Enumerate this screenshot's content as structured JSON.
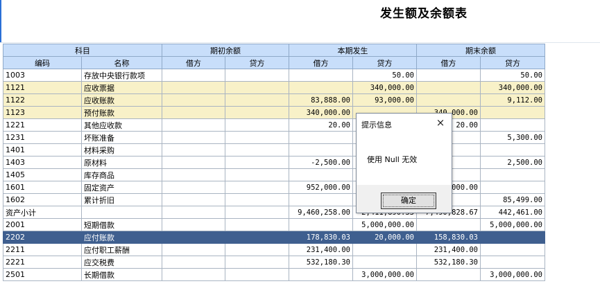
{
  "title": "发生额及余额表",
  "headers": {
    "group": [
      "科目",
      "期初余额",
      "本期发生",
      "期末余额"
    ],
    "sub": [
      "编码",
      "名称",
      "借方",
      "贷方",
      "借方",
      "贷方",
      "借方",
      "贷方"
    ]
  },
  "rows": [
    {
      "code": "1003",
      "name": "存放中央银行款项",
      "ob_debit": "",
      "ob_credit": "",
      "p_debit": "",
      "p_credit": "50.00",
      "cb_debit": "",
      "cb_credit": "50.00",
      "style": ""
    },
    {
      "code": "1121",
      "name": "应收票据",
      "ob_debit": "",
      "ob_credit": "",
      "p_debit": "",
      "p_credit": "340,000.00",
      "cb_debit": "",
      "cb_credit": "340,000.00",
      "style": "hl"
    },
    {
      "code": "1122",
      "name": "应收账款",
      "ob_debit": "",
      "ob_credit": "",
      "p_debit": "83,888.00",
      "p_credit": "93,000.00",
      "cb_debit": "",
      "cb_credit": "9,112.00",
      "style": "hl"
    },
    {
      "code": "1123",
      "name": "预付账款",
      "ob_debit": "",
      "ob_credit": "",
      "p_debit": "340,000.00",
      "p_credit": "",
      "cb_debit": "340,000.00",
      "cb_credit": "",
      "style": "hl"
    },
    {
      "code": "1221",
      "name": "其他应收款",
      "ob_debit": "",
      "ob_credit": "",
      "p_debit": "20.00",
      "p_credit": "",
      "cb_debit": "20.00",
      "cb_credit": "",
      "style": ""
    },
    {
      "code": "1231",
      "name": "坏账准备",
      "ob_debit": "",
      "ob_credit": "",
      "p_debit": "",
      "p_credit": "",
      "cb_debit": "",
      "cb_credit": "5,300.00",
      "style": ""
    },
    {
      "code": "1401",
      "name": "材料采购",
      "ob_debit": "",
      "ob_credit": "",
      "p_debit": "",
      "p_credit": "",
      "cb_debit": "",
      "cb_credit": "",
      "style": ""
    },
    {
      "code": "1403",
      "name": "原材料",
      "ob_debit": "",
      "ob_credit": "",
      "p_debit": "-2,500.00",
      "p_credit": "",
      "cb_debit": "",
      "cb_credit": "2,500.00",
      "style": ""
    },
    {
      "code": "1405",
      "name": "库存商品",
      "ob_debit": "",
      "ob_credit": "",
      "p_debit": "",
      "p_credit": "",
      "cb_debit": "",
      "cb_credit": "",
      "style": ""
    },
    {
      "code": "1601",
      "name": "固定资产",
      "ob_debit": "",
      "ob_credit": "",
      "p_debit": "952,000.00",
      "p_credit": "",
      "cb_debit": "952,000.00",
      "cb_credit": "",
      "style": ""
    },
    {
      "code": "1602",
      "name": "累计折旧",
      "ob_debit": "",
      "ob_credit": "",
      "p_debit": "",
      "p_credit": "",
      "cb_debit": "",
      "cb_credit": "85,499.00",
      "style": ""
    },
    {
      "code": "资产小计",
      "name": "",
      "ob_debit": "",
      "ob_credit": "",
      "p_debit": "9,460,258.00",
      "p_credit": "2,411,890.33",
      "cb_debit": "7,490,828.67",
      "cb_credit": "442,461.00",
      "style": "subtotal"
    },
    {
      "code": "2001",
      "name": "短期借款",
      "ob_debit": "",
      "ob_credit": "",
      "p_debit": "",
      "p_credit": "5,000,000.00",
      "cb_debit": "",
      "cb_credit": "5,000,000.00",
      "style": ""
    },
    {
      "code": "2202",
      "name": "应付账款",
      "ob_debit": "",
      "ob_credit": "",
      "p_debit": "178,830.03",
      "p_credit": "20,000.00",
      "cb_debit": "158,830.03",
      "cb_credit": "",
      "style": "sel"
    },
    {
      "code": "2211",
      "name": "应付职工薪酬",
      "ob_debit": "",
      "ob_credit": "",
      "p_debit": "231,400.00",
      "p_credit": "",
      "cb_debit": "231,400.00",
      "cb_credit": "",
      "style": ""
    },
    {
      "code": "2221",
      "name": "应交税费",
      "ob_debit": "",
      "ob_credit": "",
      "p_debit": "532,180.30",
      "p_credit": "",
      "cb_debit": "532,180.30",
      "cb_credit": "",
      "style": ""
    },
    {
      "code": "2501",
      "name": "长期借款",
      "ob_debit": "",
      "ob_credit": "",
      "p_debit": "",
      "p_credit": "3,000,000.00",
      "cb_debit": "",
      "cb_credit": "3,000,000.00",
      "style": ""
    }
  ],
  "dialog": {
    "title": "提示信息",
    "close_icon": "×",
    "message": "使用 Null 无效",
    "ok_label": "确定"
  }
}
